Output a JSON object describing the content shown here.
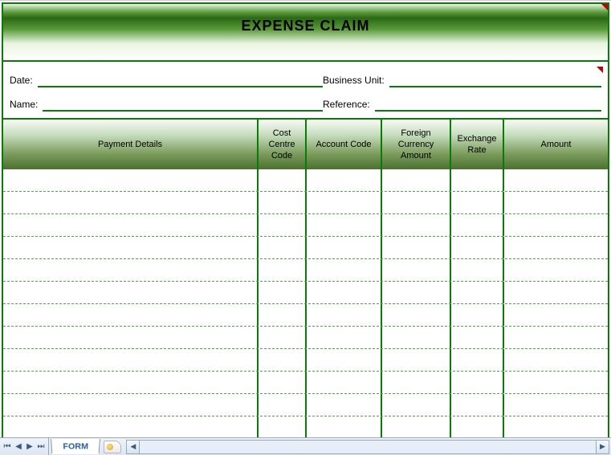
{
  "title": "EXPENSE CLAIM",
  "fields": {
    "date_label": "Date:",
    "date_value": "",
    "name_label": "Name:",
    "name_value": "",
    "business_unit_label": "Business Unit:",
    "business_unit_value": "",
    "reference_label": "Reference:",
    "reference_value": ""
  },
  "columns": {
    "payment_details": "Payment Details",
    "cost_centre_code": "Cost Centre Code",
    "account_code": "Account Code",
    "foreign_currency_amount": "Foreign Currency Amount",
    "exchange_rate": "Exchange Rate",
    "amount": "Amount"
  },
  "rows": [
    {
      "payment_details": "",
      "cost_centre_code": "",
      "account_code": "",
      "foreign_currency_amount": "",
      "exchange_rate": "",
      "amount": ""
    },
    {
      "payment_details": "",
      "cost_centre_code": "",
      "account_code": "",
      "foreign_currency_amount": "",
      "exchange_rate": "",
      "amount": ""
    },
    {
      "payment_details": "",
      "cost_centre_code": "",
      "account_code": "",
      "foreign_currency_amount": "",
      "exchange_rate": "",
      "amount": ""
    },
    {
      "payment_details": "",
      "cost_centre_code": "",
      "account_code": "",
      "foreign_currency_amount": "",
      "exchange_rate": "",
      "amount": ""
    },
    {
      "payment_details": "",
      "cost_centre_code": "",
      "account_code": "",
      "foreign_currency_amount": "",
      "exchange_rate": "",
      "amount": ""
    },
    {
      "payment_details": "",
      "cost_centre_code": "",
      "account_code": "",
      "foreign_currency_amount": "",
      "exchange_rate": "",
      "amount": ""
    },
    {
      "payment_details": "",
      "cost_centre_code": "",
      "account_code": "",
      "foreign_currency_amount": "",
      "exchange_rate": "",
      "amount": ""
    },
    {
      "payment_details": "",
      "cost_centre_code": "",
      "account_code": "",
      "foreign_currency_amount": "",
      "exchange_rate": "",
      "amount": ""
    },
    {
      "payment_details": "",
      "cost_centre_code": "",
      "account_code": "",
      "foreign_currency_amount": "",
      "exchange_rate": "",
      "amount": ""
    },
    {
      "payment_details": "",
      "cost_centre_code": "",
      "account_code": "",
      "foreign_currency_amount": "",
      "exchange_rate": "",
      "amount": ""
    },
    {
      "payment_details": "",
      "cost_centre_code": "",
      "account_code": "",
      "foreign_currency_amount": "",
      "exchange_rate": "",
      "amount": ""
    },
    {
      "payment_details": "",
      "cost_centre_code": "",
      "account_code": "",
      "foreign_currency_amount": "",
      "exchange_rate": "",
      "amount": ""
    }
  ],
  "tabs": {
    "active": "FORM"
  },
  "colors": {
    "border_green": "#0a7a0a",
    "dash_green": "#5aa050"
  }
}
